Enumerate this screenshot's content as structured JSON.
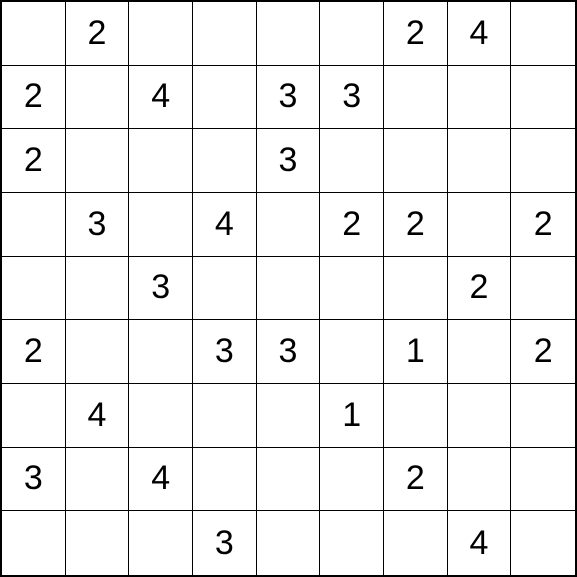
{
  "puzzle": {
    "size": 9,
    "cells": [
      [
        "",
        "2",
        "",
        "",
        "",
        "",
        "2",
        "4",
        ""
      ],
      [
        "2",
        "",
        "4",
        "",
        "3",
        "3",
        "",
        "",
        ""
      ],
      [
        "2",
        "",
        "",
        "",
        "3",
        "",
        "",
        "",
        ""
      ],
      [
        "",
        "3",
        "",
        "4",
        "",
        "2",
        "2",
        "",
        "2"
      ],
      [
        "",
        "",
        "3",
        "",
        "",
        "",
        "",
        "2",
        ""
      ],
      [
        "2",
        "",
        "",
        "3",
        "3",
        "",
        "1",
        "",
        "2"
      ],
      [
        "",
        "4",
        "",
        "",
        "",
        "1",
        "",
        "",
        ""
      ],
      [
        "3",
        "",
        "4",
        "",
        "",
        "",
        "2",
        "",
        ""
      ],
      [
        "",
        "",
        "",
        "3",
        "",
        "",
        "",
        "4",
        ""
      ]
    ]
  }
}
